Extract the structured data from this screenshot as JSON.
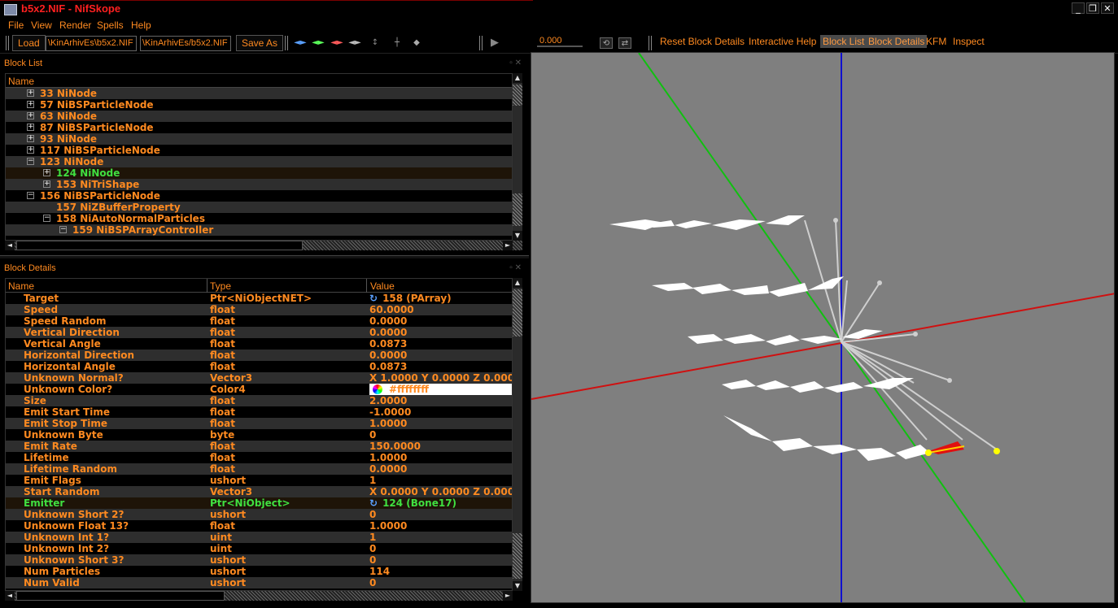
{
  "window": {
    "title": "b5x2.NIF - NifSkope",
    "minimize": "_",
    "restore": "❐",
    "close": "✕"
  },
  "menu": [
    "File",
    "View",
    "Render",
    "Spells",
    "Help"
  ],
  "toolbar": {
    "load_label": "Load",
    "load_path": "\\KinArhivEs\\b5x2.NIF",
    "save_path": "\\KinArhivEs/b5x2.NIF",
    "save_as_label": "Save As",
    "time_value": "0.000",
    "reset_block_details": "Reset Block Details",
    "interactive_help": "Interactive Help",
    "block_list": "Block List",
    "block_details": "Block Details",
    "kfm": "KFM",
    "inspect": "Inspect"
  },
  "block_list": {
    "title": "Block List",
    "column": "Name",
    "rows": [
      {
        "label": "33 NiNode",
        "exp": "+"
      },
      {
        "label": "57 NiBSParticleNode",
        "exp": "+"
      },
      {
        "label": "63 NiNode",
        "exp": "+"
      },
      {
        "label": "87 NiBSParticleNode",
        "exp": "+"
      },
      {
        "label": "93 NiNode",
        "exp": "+"
      },
      {
        "label": "117 NiBSParticleNode",
        "exp": "+"
      },
      {
        "label": "123 NiNode",
        "exp": "−"
      },
      {
        "label": "124 NiNode",
        "exp": "+"
      },
      {
        "label": "153 NiTriShape",
        "exp": "+"
      },
      {
        "label": "156 NiBSParticleNode",
        "exp": "−"
      },
      {
        "label": "157 NiZBufferProperty",
        "exp": ""
      },
      {
        "label": "158 NiAutoNormalParticles",
        "exp": "−"
      },
      {
        "label": "159 NiBSPArrayController",
        "exp": "−"
      }
    ]
  },
  "block_details": {
    "title": "Block Details",
    "columns": {
      "name": "Name",
      "type": "Type",
      "value": "Value"
    },
    "rows": [
      {
        "name": "Target",
        "type": "Ptr<NiObjectNET>",
        "value": "158 (PArray)"
      },
      {
        "name": "Speed",
        "type": "float",
        "value": "60.0000"
      },
      {
        "name": "Speed Random",
        "type": "float",
        "value": "0.0000"
      },
      {
        "name": "Vertical Direction",
        "type": "float",
        "value": "0.0000"
      },
      {
        "name": "Vertical Angle",
        "type": "float",
        "value": "0.0873"
      },
      {
        "name": "Horizontal Direction",
        "type": "float",
        "value": "0.0000"
      },
      {
        "name": "Horizontal Angle",
        "type": "float",
        "value": "0.0873"
      },
      {
        "name": "Unknown Normal?",
        "type": "Vector3",
        "value": "X 1.0000 Y 0.0000 Z 0.0000"
      },
      {
        "name": "Unknown Color?",
        "type": "Color4",
        "value": "#ffffffff"
      },
      {
        "name": "Size",
        "type": "float",
        "value": "2.0000"
      },
      {
        "name": "Emit Start Time",
        "type": "float",
        "value": "-1.0000"
      },
      {
        "name": "Emit Stop Time",
        "type": "float",
        "value": "1.0000"
      },
      {
        "name": "Unknown Byte",
        "type": "byte",
        "value": "0"
      },
      {
        "name": "Emit Rate",
        "type": "float",
        "value": "150.0000"
      },
      {
        "name": "Lifetime",
        "type": "float",
        "value": "1.0000"
      },
      {
        "name": "Lifetime Random",
        "type": "float",
        "value": "0.0000"
      },
      {
        "name": "Emit Flags",
        "type": "ushort",
        "value": "1"
      },
      {
        "name": "Start Random",
        "type": "Vector3",
        "value": "X 0.0000 Y 0.0000 Z 0.0000"
      },
      {
        "name": "Emitter",
        "type": "Ptr<NiObject>",
        "value": "124 (Bone17)"
      },
      {
        "name": "Unknown Short 2?",
        "type": "ushort",
        "value": "0"
      },
      {
        "name": "Unknown Float 13?",
        "type": "float",
        "value": "1.0000"
      },
      {
        "name": "Unknown Int 1?",
        "type": "uint",
        "value": "1"
      },
      {
        "name": "Unknown Int 2?",
        "type": "uint",
        "value": "0"
      },
      {
        "name": "Unknown Short 3?",
        "type": "ushort",
        "value": "0"
      },
      {
        "name": "Num Particles",
        "type": "ushort",
        "value": "114"
      },
      {
        "name": "Num Valid",
        "type": "ushort",
        "value": "0"
      }
    ]
  },
  "colors": {
    "accent": "#ff8a20",
    "selected": "#40e040",
    "viewport_bg": "#7f7f7f",
    "axis_x": "#d01010",
    "axis_y": "#10c010",
    "axis_z": "#1010d0"
  }
}
